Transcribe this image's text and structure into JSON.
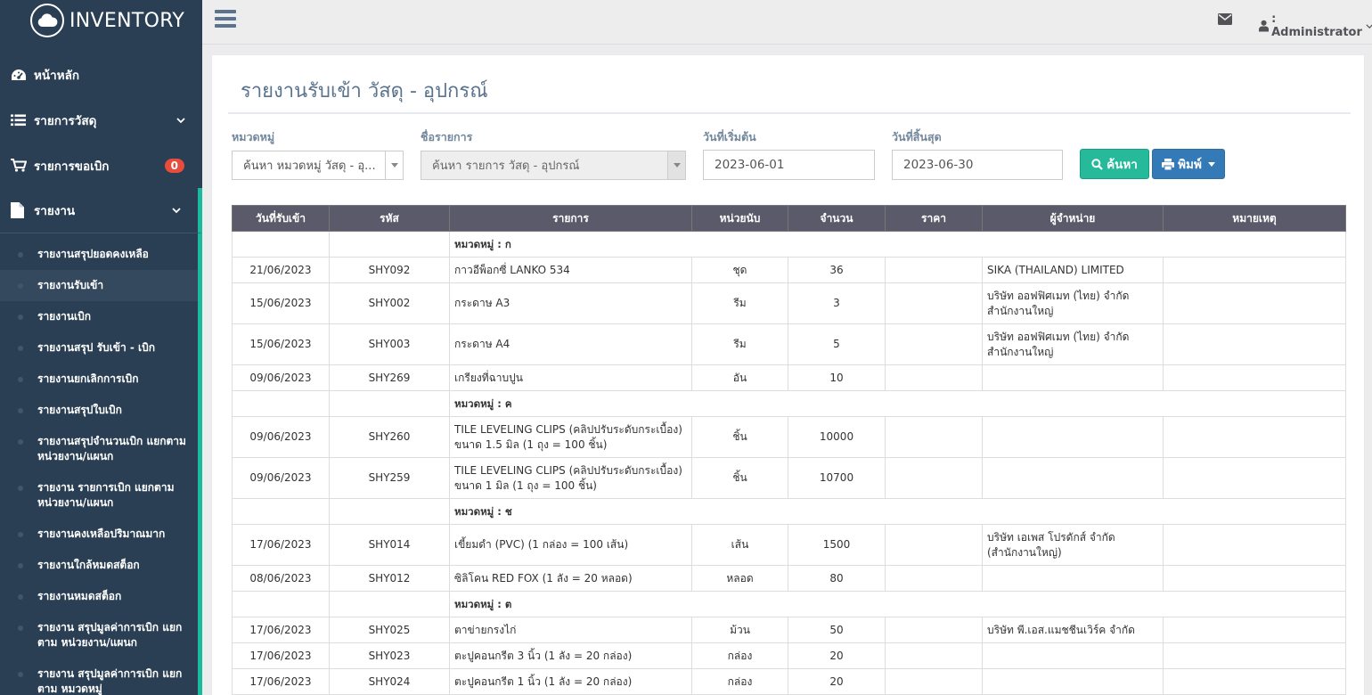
{
  "app": {
    "brand": "INVENTORY"
  },
  "sidebar": {
    "items": [
      {
        "label": "หน้าหลัก"
      },
      {
        "label": "รายการวัสดุ"
      },
      {
        "label": "รายการขอเบิก",
        "badge": "0"
      },
      {
        "label": "รายงาน"
      }
    ],
    "report_subitems": [
      {
        "label": "รายงานสรุปยอดคงเหลือ"
      },
      {
        "label": "รายงานรับเข้า"
      },
      {
        "label": "รายงานเบิก"
      },
      {
        "label": "รายงานสรุป รับเข้า - เบิก"
      },
      {
        "label": "รายงานยกเลิกการเบิก"
      },
      {
        "label": "รายงานสรุปใบเบิก"
      },
      {
        "label": "รายงานสรุปจำนวนเบิก แยกตาม หน่วยงาน/แผนก"
      },
      {
        "label": "รายงาน รายการเบิก แยกตาม หน่วยงาน/แผนก"
      },
      {
        "label": "รายงานคงเหลือปริมาณมาก"
      },
      {
        "label": "รายงานใกล้หมดสต็อก"
      },
      {
        "label": "รายงานหมดสต็อก"
      },
      {
        "label": "รายงาน สรุปมูลค่าการเบิก แยก ตาม หน่วยงาน/แผนก"
      },
      {
        "label": "รายงาน สรุปมูลค่าการเบิก แยก ตาม หมวดหมู่"
      }
    ]
  },
  "header": {
    "user": ": Administrator"
  },
  "page": {
    "title": "รายงานรับเข้า วัสดุ - อุปกรณ์",
    "filters": {
      "category_label": "หมวดหมู่",
      "category_value": "ค้นหา หมวดหมู่ วัสดุ - อุ...",
      "item_label": "ชื่อรายการ",
      "item_value": "ค้นหา รายการ วัสดุ - อุปกรณ์",
      "start_label": "วันที่เริ่มต้น",
      "start_value": "2023-06-01",
      "end_label": "วันที่สิ้นสุด",
      "end_value": "2023-06-30",
      "search_label": "ค้นหา",
      "print_label": "พิมพ์"
    },
    "table": {
      "headers": [
        "วันที่รับเข้า",
        "รหัส",
        "รายการ",
        "หน่วยนับ",
        "จำนวน",
        "ราคา",
        "ผู้จำหน่าย",
        "หมายเหตุ"
      ],
      "groups": [
        {
          "category": "หมวดหมู่ : ก",
          "rows": [
            {
              "date": "21/06/2023",
              "code": "SHY092",
              "name": "กาวอีพ็อกซี่ LANKO 534",
              "unit": "ชุด",
              "qty": "36",
              "price": "",
              "vendor": "SIKA (THAILAND) LIMITED",
              "note": ""
            },
            {
              "date": "15/06/2023",
              "code": "SHY002",
              "name": "กระดาษ A3",
              "unit": "รีม",
              "qty": "3",
              "price": "",
              "vendor": "บริษัท ออฟฟิศเมท (ไทย) จำกัด สำนักงานใหญ่",
              "note": ""
            },
            {
              "date": "15/06/2023",
              "code": "SHY003",
              "name": "กระดาษ A4",
              "unit": "รีม",
              "qty": "5",
              "price": "",
              "vendor": "บริษัท ออฟฟิศเมท (ไทย) จำกัด สำนักงานใหญ่",
              "note": ""
            },
            {
              "date": "09/06/2023",
              "code": "SHY269",
              "name": "เกรียงที่ฉาบปูน",
              "unit": "อัน",
              "qty": "10",
              "price": "",
              "vendor": "",
              "note": ""
            }
          ]
        },
        {
          "category": "หมวดหมู่ : ค",
          "rows": [
            {
              "date": "09/06/2023",
              "code": "SHY260",
              "name": "TILE LEVELING CLIPS (คลิปปรับระดับกระเบื้อง) ขนาด 1.5 มิล (1 ถุง = 100 ชิ้น)",
              "unit": "ชิ้น",
              "qty": "10000",
              "price": "",
              "vendor": "",
              "note": ""
            },
            {
              "date": "09/06/2023",
              "code": "SHY259",
              "name": "TILE LEVELING CLIPS (คลิปปรับระดับกระเบื้อง) ขนาด 1 มิล (1 ถุง = 100 ชิ้น)",
              "unit": "ชิ้น",
              "qty": "10700",
              "price": "",
              "vendor": "",
              "note": ""
            }
          ]
        },
        {
          "category": "หมวดหมู่ : ช",
          "rows": [
            {
              "date": "17/06/2023",
              "code": "SHY014",
              "name": "เขี้ยมดำ (PVC) (1 กล่อง = 100 เส้น)",
              "unit": "เส้น",
              "qty": "1500",
              "price": "",
              "vendor": "บริษัท เอเพส โปรดักส์ จำกัด (สำนักงานใหญ่)",
              "note": ""
            },
            {
              "date": "08/06/2023",
              "code": "SHY012",
              "name": "ซิลิโคน RED FOX (1 ลัง = 20 หลอด)",
              "unit": "หลอด",
              "qty": "80",
              "price": "",
              "vendor": "",
              "note": ""
            }
          ]
        },
        {
          "category": "หมวดหมู่ : ต",
          "rows": [
            {
              "date": "17/06/2023",
              "code": "SHY025",
              "name": "ตาข่ายกรงไก่",
              "unit": "ม้วน",
              "qty": "50",
              "price": "",
              "vendor": "บริษัท พี.เอส.แมชชีนเวิร์ค จำกัด",
              "note": ""
            },
            {
              "date": "17/06/2023",
              "code": "SHY023",
              "name": "ตะปูคอนกรีต 3 นิ้ว (1 ลัง = 20 กล่อง)",
              "unit": "กล่อง",
              "qty": "20",
              "price": "",
              "vendor": "",
              "note": ""
            },
            {
              "date": "17/06/2023",
              "code": "SHY024",
              "name": "ตะปูคอนกรีต 1 นิ้ว (1 ลัง = 20 กล่อง)",
              "unit": "กล่อง",
              "qty": "20",
              "price": "",
              "vendor": "",
              "note": ""
            }
          ]
        }
      ]
    }
  }
}
